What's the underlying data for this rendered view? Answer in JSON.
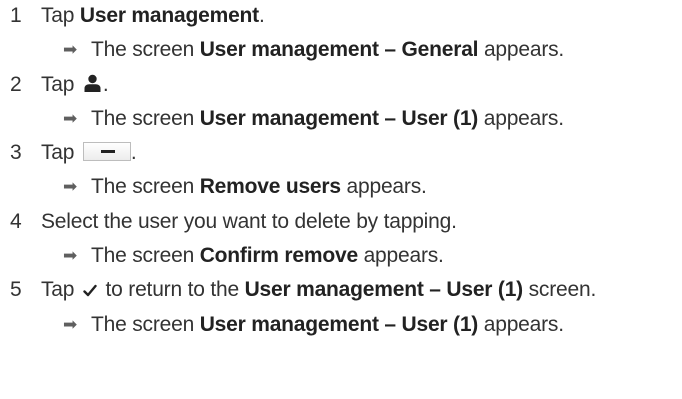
{
  "steps": [
    {
      "number": "1",
      "pre": "Tap ",
      "bold": "User management",
      "post": ".",
      "result": {
        "pre": "The screen ",
        "bold": "User management – General",
        "post": " appears."
      }
    },
    {
      "number": "2",
      "pre": "Tap ",
      "icon": "user-icon",
      "post": ".",
      "result": {
        "pre": "The screen ",
        "bold": "User management – User (1)",
        "post": " appears."
      }
    },
    {
      "number": "3",
      "pre": "Tap ",
      "icon": "minus-button-icon",
      "post": ".",
      "result": {
        "pre": "The screen ",
        "bold": "Remove users",
        "post": " appears."
      }
    },
    {
      "number": "4",
      "text": "Select the user you want to delete by tapping.",
      "result": {
        "pre": "The screen ",
        "bold": "Confirm remove",
        "post": " appears."
      }
    },
    {
      "number": "5",
      "pre": "Tap ",
      "icon": "checkmark-icon",
      "mid": " to return to the ",
      "bold": "User management – User (1)",
      "post": " screen.",
      "result": {
        "pre": "The screen ",
        "bold": "User management – User (1)",
        "post": " appears."
      }
    }
  ],
  "result_marker": "➡"
}
